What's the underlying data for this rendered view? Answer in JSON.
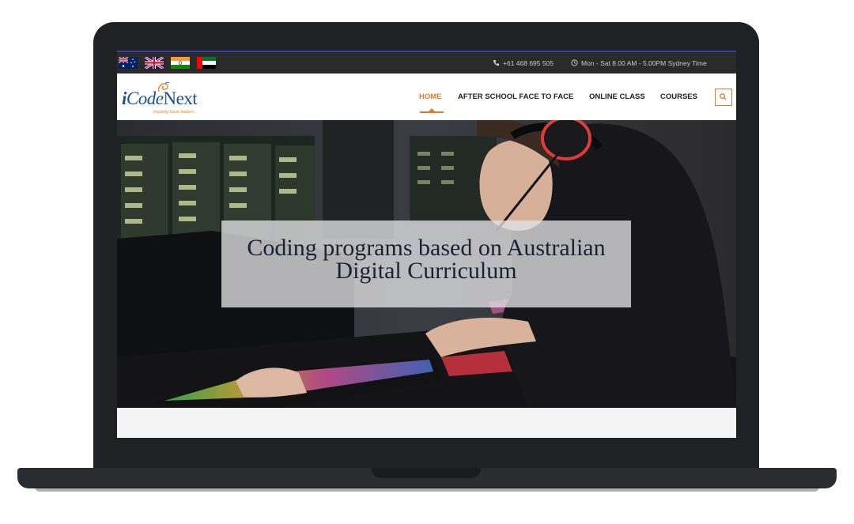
{
  "topbar": {
    "flags": [
      "australia-flag",
      "uk-flag",
      "india-flag",
      "uae-flag"
    ],
    "phone": "+61 468 695 505",
    "hours": "Mon - Sat 8.00 AM - 5.00PM Sydney Time"
  },
  "header": {
    "logo_text_i": "i",
    "logo_text_code": "Code",
    "logo_text_next": "Next",
    "logo_tagline": "Inspiring future leaders...",
    "nav": [
      {
        "label": "HOME",
        "active": true
      },
      {
        "label": "AFTER SCHOOL FACE TO FACE"
      },
      {
        "label": "ONLINE CLASS"
      },
      {
        "label": "COURSES"
      }
    ],
    "search_icon": "search-icon"
  },
  "hero": {
    "title": "Coding programs based on Australian Digital Curriculum"
  },
  "colors": {
    "accent": "#e57a26",
    "brand_blue": "#1b4f9c",
    "topbar_bg": "#2a2a2a"
  }
}
